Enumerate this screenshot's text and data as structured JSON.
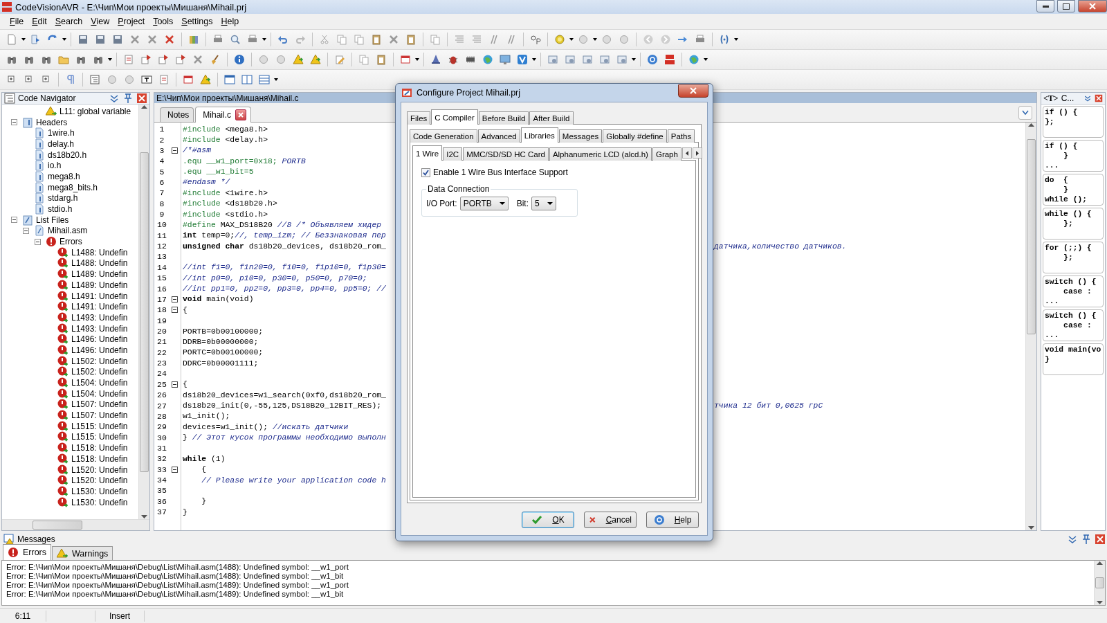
{
  "window": {
    "title": "CodeVisionAVR - E:\\Чип\\Мои проекты\\Мишаня\\Mihail.prj"
  },
  "menu": [
    "File",
    "Edit",
    "Search",
    "View",
    "Project",
    "Tools",
    "Settings",
    "Help"
  ],
  "navigator": {
    "title": "Code Navigator",
    "tree": [
      {
        "children": [
          {
            "children": [
              {
                "label": "L11: global variable",
                "kind": "warning"
              }
            ]
          }
        ]
      },
      {
        "label": "Headers",
        "kind": "header-folder",
        "expanded": true,
        "children": [
          {
            "label": "1wire.h",
            "kind": "header"
          },
          {
            "label": "delay.h",
            "kind": "header"
          },
          {
            "label": "ds18b20.h",
            "kind": "header"
          },
          {
            "label": "io.h",
            "kind": "header"
          },
          {
            "label": "mega8.h",
            "kind": "header"
          },
          {
            "label": "mega8_bits.h",
            "kind": "header"
          },
          {
            "label": "stdarg.h",
            "kind": "header"
          },
          {
            "label": "stdio.h",
            "kind": "header"
          }
        ]
      },
      {
        "label": "List Files",
        "kind": "list-folder",
        "expanded": true,
        "children": [
          {
            "label": "Mihail.asm",
            "kind": "list",
            "expanded": true,
            "children": [
              {
                "label": "Errors",
                "kind": "errors",
                "expanded": true,
                "children": [
                  {
                    "label": "L1488: Undefin",
                    "kind": "error"
                  },
                  {
                    "label": "L1488: Undefin",
                    "kind": "error"
                  },
                  {
                    "label": "L1489: Undefin",
                    "kind": "error"
                  },
                  {
                    "label": "L1489: Undefin",
                    "kind": "error"
                  },
                  {
                    "label": "L1491: Undefin",
                    "kind": "error"
                  },
                  {
                    "label": "L1491: Undefin",
                    "kind": "error"
                  },
                  {
                    "label": "L1493: Undefin",
                    "kind": "error"
                  },
                  {
                    "label": "L1493: Undefin",
                    "kind": "error"
                  },
                  {
                    "label": "L1496: Undefin",
                    "kind": "error"
                  },
                  {
                    "label": "L1496: Undefin",
                    "kind": "error"
                  },
                  {
                    "label": "L1502: Undefin",
                    "kind": "error"
                  },
                  {
                    "label": "L1502: Undefin",
                    "kind": "error"
                  },
                  {
                    "label": "L1504: Undefin",
                    "kind": "error"
                  },
                  {
                    "label": "L1504: Undefin",
                    "kind": "error"
                  },
                  {
                    "label": "L1507: Undefin",
                    "kind": "error"
                  },
                  {
                    "label": "L1507: Undefin",
                    "kind": "error"
                  },
                  {
                    "label": "L1515: Undefin",
                    "kind": "error"
                  },
                  {
                    "label": "L1515: Undefin",
                    "kind": "error"
                  },
                  {
                    "label": "L1518: Undefin",
                    "kind": "error"
                  },
                  {
                    "label": "L1518: Undefin",
                    "kind": "error"
                  },
                  {
                    "label": "L1520: Undefin",
                    "kind": "error"
                  },
                  {
                    "label": "L1520: Undefin",
                    "kind": "error"
                  },
                  {
                    "label": "L1530: Undefin",
                    "kind": "error"
                  },
                  {
                    "label": "L1530: Undefin",
                    "kind": "error"
                  }
                ]
              }
            ]
          }
        ]
      }
    ]
  },
  "editor": {
    "path": "E:\\Чип\\Мои проекты\\Мишаня\\Mihail.c",
    "tabs": [
      {
        "label": "Notes",
        "selected": false,
        "closable": false
      },
      {
        "label": "Mihail.c",
        "selected": true,
        "closable": true
      }
    ],
    "lines": [
      {
        "n": "1",
        "parts": [
          {
            "kind": "directive",
            "text": "#include"
          },
          {
            "kind": "code",
            "text": " <mega8.h>"
          }
        ]
      },
      {
        "n": "2",
        "parts": [
          {
            "kind": "directive",
            "text": "#include"
          },
          {
            "kind": "code",
            "text": " <delay.h>"
          }
        ]
      },
      {
        "n": "3",
        "fold": true,
        "parts": [
          {
            "kind": "comment",
            "text": "/*#asm"
          }
        ]
      },
      {
        "n": "4",
        "parts": [
          {
            "kind": "directive",
            "text": ".equ __w1_port=0x18;"
          },
          {
            "kind": "comment",
            "text": " PORTB"
          }
        ]
      },
      {
        "n": "5",
        "parts": [
          {
            "kind": "directive",
            "text": ".equ __w1_bit=5"
          }
        ]
      },
      {
        "n": "6",
        "parts": [
          {
            "kind": "comment",
            "text": "#endasm */"
          }
        ]
      },
      {
        "n": "7",
        "parts": [
          {
            "kind": "directive",
            "text": "#include"
          },
          {
            "kind": "code",
            "text": " <1wire.h>"
          }
        ]
      },
      {
        "n": "8",
        "parts": [
          {
            "kind": "directive",
            "text": "#include"
          },
          {
            "kind": "code",
            "text": " <ds18b20.h>"
          }
        ]
      },
      {
        "n": "9",
        "parts": [
          {
            "kind": "directive",
            "text": "#include"
          },
          {
            "kind": "code",
            "text": " <stdio.h>"
          }
        ]
      },
      {
        "n": "10",
        "parts": [
          {
            "kind": "directive",
            "text": "#define"
          },
          {
            "kind": "code",
            "text": " MAX_DS18B20 "
          },
          {
            "kind": "comment",
            "text": "//8 /* Объявляем хидер"
          }
        ]
      },
      {
        "n": "11",
        "parts": [
          {
            "kind": "keyword",
            "text": "int"
          },
          {
            "kind": "code",
            "text": " temp=0;"
          },
          {
            "kind": "comment",
            "text": "//, temp_izm; // Беззнаковая пер"
          }
        ]
      },
      {
        "n": "12",
        "parts": [
          {
            "kind": "keyword",
            "text": "unsigned char"
          },
          {
            "kind": "code",
            "text": " ds18b20_devices, ds18b20_rom_"
          }
        ],
        "tail": "датчика,количество датчиков."
      },
      {
        "n": "13"
      },
      {
        "n": "14",
        "parts": [
          {
            "kind": "comment",
            "text": "//int f1=0, f1n20=0, f10=0, f1p10=0, f1p30="
          }
        ]
      },
      {
        "n": "15",
        "parts": [
          {
            "kind": "comment",
            "text": "//int p0=0, p10=0, p30=0, p50=0, p70=0;"
          }
        ]
      },
      {
        "n": "16",
        "parts": [
          {
            "kind": "comment",
            "text": "//int pp1=0, pp2=0, pp3=0, pp4=0, pp5=0; //"
          }
        ]
      },
      {
        "n": "17",
        "fold": true,
        "parts": [
          {
            "kind": "keyword",
            "text": "void"
          },
          {
            "kind": "code",
            "text": " main(void)"
          }
        ]
      },
      {
        "n": "18",
        "fold": true,
        "parts": [
          {
            "kind": "code",
            "text": "{"
          }
        ]
      },
      {
        "n": "19"
      },
      {
        "n": "20",
        "parts": [
          {
            "kind": "code",
            "text": "PORTB=0b00100000;"
          }
        ]
      },
      {
        "n": "21",
        "parts": [
          {
            "kind": "code",
            "text": "DDRB=0b00000000;"
          }
        ]
      },
      {
        "n": "22",
        "parts": [
          {
            "kind": "code",
            "text": "PORTC=0b00100000;"
          }
        ]
      },
      {
        "n": "23",
        "parts": [
          {
            "kind": "code",
            "text": "DDRC=0b00001111;"
          }
        ]
      },
      {
        "n": "24"
      },
      {
        "n": "25",
        "fold": true,
        "parts": [
          {
            "kind": "code",
            "text": "{"
          }
        ]
      },
      {
        "n": "26",
        "parts": [
          {
            "kind": "code",
            "text": "ds18b20_devices=w1_search(0xf0,ds18b20_rom_"
          }
        ]
      },
      {
        "n": "27",
        "parts": [
          {
            "kind": "code",
            "text": "ds18b20_init(0,-55,125,DS18B20_12BIT_RES);"
          }
        ],
        "tail": "тчика 12 бит 0,0625 грС"
      },
      {
        "n": "28",
        "parts": [
          {
            "kind": "code",
            "text": "w1_init();"
          }
        ]
      },
      {
        "n": "29",
        "parts": [
          {
            "kind": "code",
            "text": "devices=w1_init(); "
          },
          {
            "kind": "comment",
            "text": "//искать датчики"
          }
        ]
      },
      {
        "n": "30",
        "parts": [
          {
            "kind": "code",
            "text": "} "
          },
          {
            "kind": "comment",
            "text": "// Этот кусок программы необходимо выполн"
          }
        ]
      },
      {
        "n": "31"
      },
      {
        "n": "32",
        "parts": [
          {
            "kind": "keyword",
            "text": "while"
          },
          {
            "kind": "code",
            "text": " (1)"
          }
        ]
      },
      {
        "n": "33",
        "fold": true,
        "parts": [
          {
            "kind": "code",
            "text": "    {"
          }
        ]
      },
      {
        "n": "34",
        "parts": [
          {
            "kind": "comment",
            "text": "    // Please write your application code h"
          }
        ]
      },
      {
        "n": "35"
      },
      {
        "n": "36",
        "parts": [
          {
            "kind": "code",
            "text": "    }"
          }
        ]
      },
      {
        "n": "37",
        "parts": [
          {
            "kind": "code",
            "text": "}"
          }
        ]
      }
    ]
  },
  "snippets": {
    "badge": "<T>",
    "title": "C...",
    "items": [
      "if () {\n};",
      "if () {\n    }\n...",
      "do  {\n    }\nwhile ();",
      "while () {\n    };",
      "for (;;) {\n    };",
      "switch () {\n    case :\n...",
      "switch () {\n    case :\n...",
      "void main(vo\n}"
    ]
  },
  "dialog": {
    "title": "Configure Project Mihail.prj",
    "tabs": [
      {
        "label": "Files",
        "selected": false
      },
      {
        "label": "C Compiler",
        "selected": true
      },
      {
        "label": "Before Build",
        "selected": false
      },
      {
        "label": "After Build",
        "selected": false
      }
    ],
    "subtabs": [
      {
        "label": "Code Generation",
        "selected": false
      },
      {
        "label": "Advanced",
        "selected": false
      },
      {
        "label": "Libraries",
        "selected": true
      },
      {
        "label": "Messages",
        "selected": false
      },
      {
        "label": "Globally #define",
        "selected": false
      },
      {
        "label": "Paths",
        "selected": false
      }
    ],
    "library_tabs": [
      {
        "label": "1 Wire",
        "selected": true
      },
      {
        "label": "I2C",
        "selected": false
      },
      {
        "label": "MMC/SD/SD HC Card",
        "selected": false
      },
      {
        "label": "Alphanumeric LCD (alcd.h)",
        "selected": false
      },
      {
        "label": "Graph",
        "selected": false
      }
    ],
    "enable_checkbox": {
      "label": "Enable 1 Wire Bus Interface Support",
      "checked": true
    },
    "group": {
      "title": "Data Connection",
      "port_label": "I/O Port:",
      "port": "PORTB",
      "bit_label": "Bit:",
      "bit": "5"
    },
    "buttons": [
      {
        "label": "OK",
        "kind": "ok",
        "default": true
      },
      {
        "label": "Cancel",
        "kind": "cancel",
        "default": false
      },
      {
        "label": "Help",
        "kind": "help",
        "default": false
      }
    ]
  },
  "messages": {
    "title": "Messages",
    "tabs": [
      {
        "label": "Errors",
        "kind": "error",
        "selected": true
      },
      {
        "label": "Warnings",
        "kind": "warning",
        "selected": false
      }
    ],
    "lines": [
      "Error: E:\\Чип\\Мои проекты\\Мишаня\\Debug\\List\\Mihail.asm(1488): Undefined symbol: __w1_port",
      "Error: E:\\Чип\\Мои проекты\\Мишаня\\Debug\\List\\Mihail.asm(1488): Undefined symbol: __w1_bit",
      "Error: E:\\Чип\\Мои проекты\\Мишаня\\Debug\\List\\Mihail.asm(1489): Undefined symbol: __w1_port",
      "Error: E:\\Чип\\Мои проекты\\Мишаня\\Debug\\List\\Mihail.asm(1489): Undefined symbol: __w1_bit"
    ]
  },
  "status_bar": {
    "position": "6:11",
    "mode": "Insert"
  }
}
